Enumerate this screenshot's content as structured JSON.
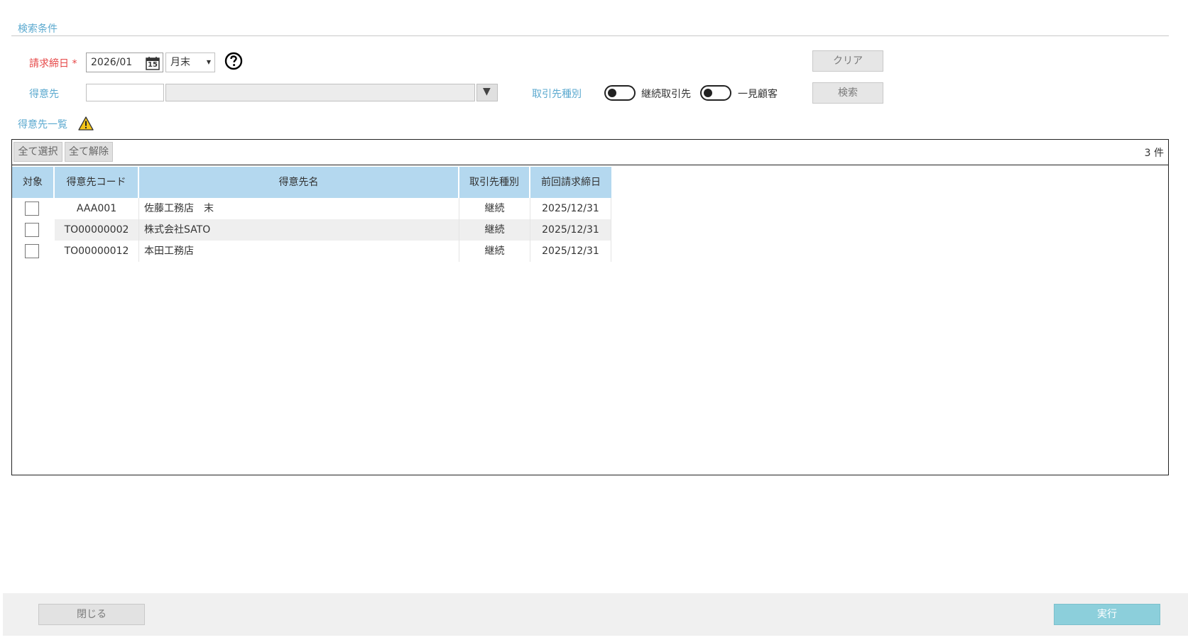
{
  "search": {
    "section_title": "検索条件",
    "closing_date_label": "請求締日",
    "required_mark": "*",
    "closing_month_value": "2026/01",
    "calendar_day": "15",
    "closing_day_value": "月末",
    "customer_label": "得意先",
    "customer_code_value": "",
    "customer_name_value": "",
    "transaction_type_label": "取引先種別",
    "toggle_continuous_label": "継続取引先",
    "toggle_onetime_label": "一見顧客",
    "clear_button": "クリア",
    "search_button": "検索"
  },
  "list": {
    "section_title": "得意先一覧",
    "select_all_button": "全て選択",
    "deselect_all_button": "全て解除",
    "count_label": "3 件",
    "columns": [
      "対象",
      "得意先コード",
      "得意先名",
      "取引先種別",
      "前回請求締日"
    ],
    "rows": [
      {
        "code": "AAA001",
        "name": "佐藤工務店　末",
        "type": "継続",
        "last_date": "2025/12/31"
      },
      {
        "code": "TO00000002",
        "name": "株式会社SATO",
        "type": "継続",
        "last_date": "2025/12/31"
      },
      {
        "code": "TO00000012",
        "name": "本田工務店",
        "type": "継続",
        "last_date": "2025/12/31"
      }
    ]
  },
  "footer": {
    "close_button": "閉じる",
    "execute_button": "実行"
  }
}
